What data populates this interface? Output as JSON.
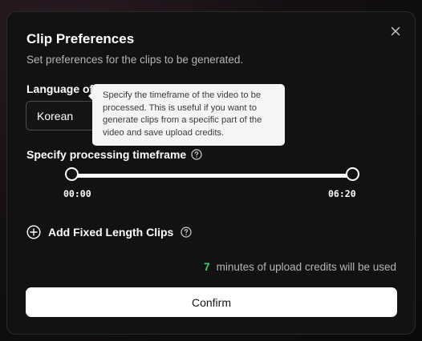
{
  "modal": {
    "title": "Clip Preferences",
    "subtitle": "Set preferences for the clips to be generated."
  },
  "language": {
    "label": "Language of",
    "value": "Korean"
  },
  "tooltip": {
    "text": "Specify the timeframe of the video to be processed. This is useful if you want to generate clips from a specific part of the video and save upload credits."
  },
  "timeframe": {
    "label": "Specify processing timeframe",
    "start": "00:00",
    "end": "06:20",
    "start_fraction": 0,
    "end_fraction": 1
  },
  "fixed_length": {
    "label": "Add Fixed Length Clips"
  },
  "credits": {
    "minutes": "7",
    "text": "minutes of upload credits will be used"
  },
  "confirm": {
    "label": "Confirm"
  },
  "colors": {
    "accent_green": "#3ecf6a",
    "modal_bg": "#121212",
    "tooltip_bg": "#f5f5f5"
  },
  "icons": {
    "close": "close-icon",
    "help": "help-circle-icon",
    "add": "plus-circle-icon"
  }
}
